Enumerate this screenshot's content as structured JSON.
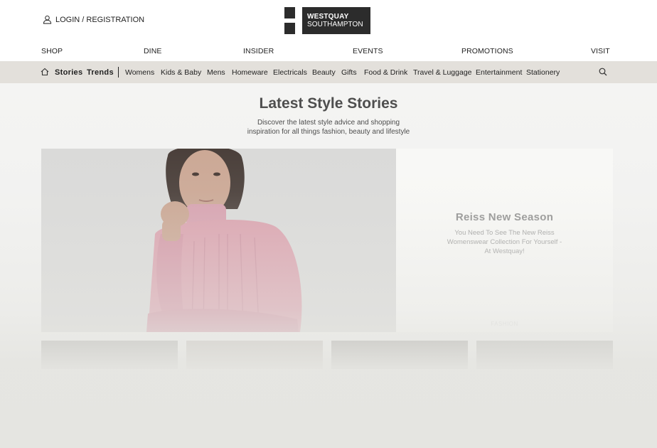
{
  "header": {
    "login_label": "LOGIN / REGISTRATION",
    "logo": {
      "line1": "WESTQUAY",
      "line2": "SOUTHAMPTON"
    }
  },
  "main_nav": [
    {
      "label": "SHOP"
    },
    {
      "label": "DINE"
    },
    {
      "label": "INSIDER"
    },
    {
      "label": "EVENTS"
    },
    {
      "label": "PROMOTIONS"
    },
    {
      "label": "VISIT"
    }
  ],
  "sub_nav": {
    "home_icon": "home-icon",
    "primary": [
      {
        "label": "Stories"
      },
      {
        "label": "Trends"
      }
    ],
    "categories": [
      {
        "label": "Womens"
      },
      {
        "label": "Kids & Baby"
      },
      {
        "label": "Mens"
      },
      {
        "label": "Homeware"
      },
      {
        "label": "Electricals"
      },
      {
        "label": "Beauty"
      },
      {
        "label": "Gifts"
      },
      {
        "label": "Food & Drink"
      },
      {
        "label": "Travel & Luggage"
      },
      {
        "label": "Entertainment"
      },
      {
        "label": "Stationery"
      }
    ],
    "search_icon": "search-icon"
  },
  "page": {
    "title": "Latest Style Stories",
    "subtitle_line1": "Discover the latest style advice and shopping",
    "subtitle_line2": "inspiration for all things fashion, beauty and lifestyle"
  },
  "featured": {
    "title": "Reiss New Season",
    "description": "You Need To See The New Reiss Womenswear Collection For Yourself - At Westquay!",
    "tag": "FASHION"
  },
  "colors": {
    "subnav_bg": "#e3e0db",
    "logo_bg": "#2c2c2c",
    "sweater": "#d99aa8"
  }
}
